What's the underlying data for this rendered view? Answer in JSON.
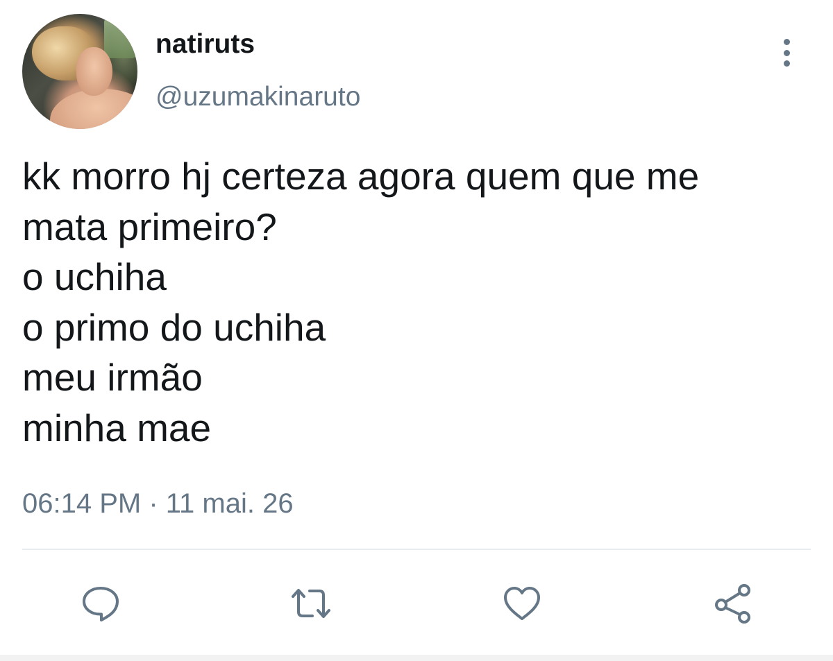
{
  "user": {
    "display_name": "natiruts",
    "handle": "@uzumakinaruto"
  },
  "tweet": {
    "lines": [
      "kk morro hj certeza agora quem que me",
      "mata primeiro?",
      "o uchiha",
      "o primo do uchiha",
      "meu irmão",
      "minha mae"
    ],
    "timestamp": "06:14 PM · 11 mai. 26"
  },
  "actions": {
    "reply_icon": "reply-icon",
    "retweet_icon": "retweet-icon",
    "like_icon": "heart-icon",
    "share_icon": "share-icon"
  },
  "colors": {
    "text_primary": "#14171a",
    "text_secondary": "#657786",
    "divider": "#e6ecf0",
    "background": "#ffffff"
  }
}
